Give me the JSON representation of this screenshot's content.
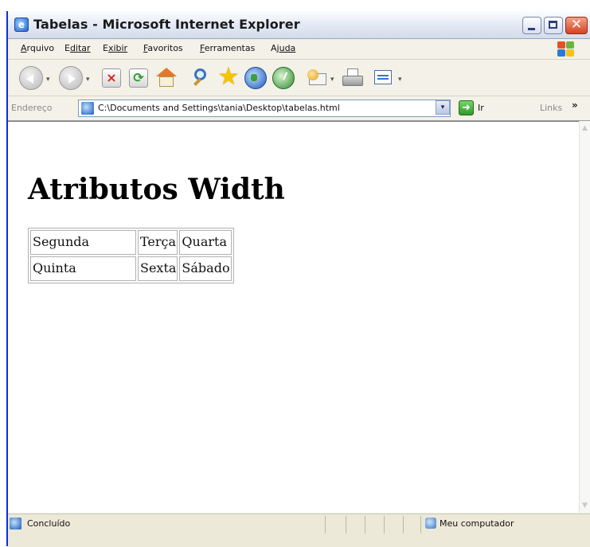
{
  "window": {
    "title": "Tabelas - Microsoft Internet Explorer",
    "close_glyph": "✕"
  },
  "menu": [
    {
      "first": "A",
      "rest": "rquivo"
    },
    {
      "first": "E",
      "rest": "ditar"
    },
    {
      "first": "E",
      "rest": "xibir"
    },
    {
      "first": "F",
      "rest": "avoritos"
    },
    {
      "first": "F",
      "rest": "erramentas"
    },
    {
      "first": "Aj",
      "rest": "uda"
    }
  ],
  "address": {
    "label": "Endereço",
    "url": "C:\\Documents and Settings\\tania\\Desktop\\tabelas.html",
    "go_label": "Ir",
    "links_label": "Links",
    "links_chevron": "»"
  },
  "toolbar": {
    "back_icon": "back-arrow-icon",
    "forward_icon": "forward-arrow-icon",
    "stop_glyph": "×",
    "refresh_glyph": "⟳",
    "star_glyph": "★",
    "dropdown_glyph": "▾"
  },
  "page": {
    "heading": "Atributos Width",
    "table": [
      [
        "Segunda",
        "Terça",
        "Quarta"
      ],
      [
        "Quinta",
        "Sexta",
        "Sábado"
      ]
    ]
  },
  "status": {
    "text": "Concluído",
    "zone": "Meu computador"
  }
}
